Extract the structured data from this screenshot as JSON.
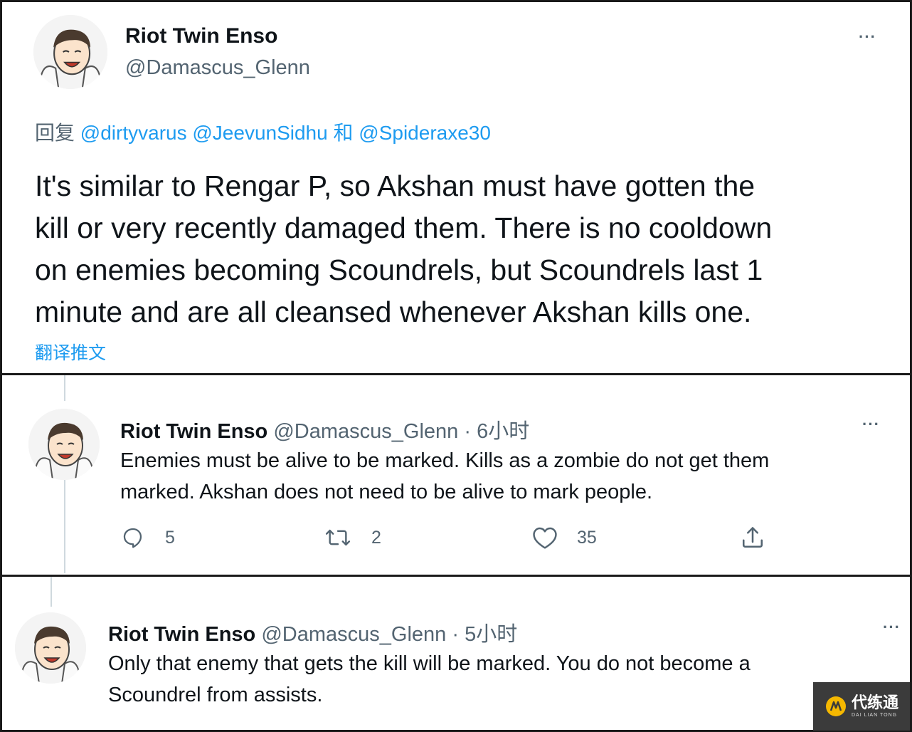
{
  "main_tweet": {
    "author_name": "Riot Twin Enso",
    "handle": "@Damascus_Glenn",
    "more": "···",
    "reply_prefix": "回复",
    "reply_to_1": "@dirtyvarus",
    "reply_to_2": "@JeevunSidhu",
    "reply_and": "和",
    "reply_to_3": "@Spideraxe30",
    "text_line1": "It's similar to Rengar P, so Akshan must have gotten the",
    "text_line2": "kill or very recently damaged them. There is no cooldown",
    "text_line3": "on enemies becoming Scoundrels, but Scoundrels last 1",
    "text_line4": "minute and are all cleansed whenever Akshan kills one.",
    "translate": "翻译推文"
  },
  "reply_1": {
    "author_name": "Riot Twin Enso",
    "handle": "@Damascus_Glenn",
    "sep": "·",
    "time": "6小时",
    "more": "···",
    "text_line1": "Enemies must be alive to be marked. Kills as a zombie do not get them",
    "text_line2": "marked. Akshan does not need to be alive to mark people.",
    "actions": {
      "replies": "5",
      "retweets": "2",
      "likes": "35"
    }
  },
  "reply_2": {
    "author_name": "Riot Twin Enso",
    "handle": "@Damascus_Glenn",
    "sep": "·",
    "time": "5小时",
    "more": "···",
    "text_line1": "Only that enemy that gets the kill will be marked. You do not become a",
    "text_line2": "Scoundrel from assists."
  },
  "watermark": {
    "main": "代练通",
    "sub": "DAI LIAN TONG"
  },
  "icons": {
    "reply": "reply-icon",
    "retweet": "retweet-icon",
    "like": "heart-icon",
    "share": "share-icon"
  },
  "colors": {
    "link": "#1d9bf0",
    "secondary": "#536471",
    "text": "#0f1419"
  }
}
